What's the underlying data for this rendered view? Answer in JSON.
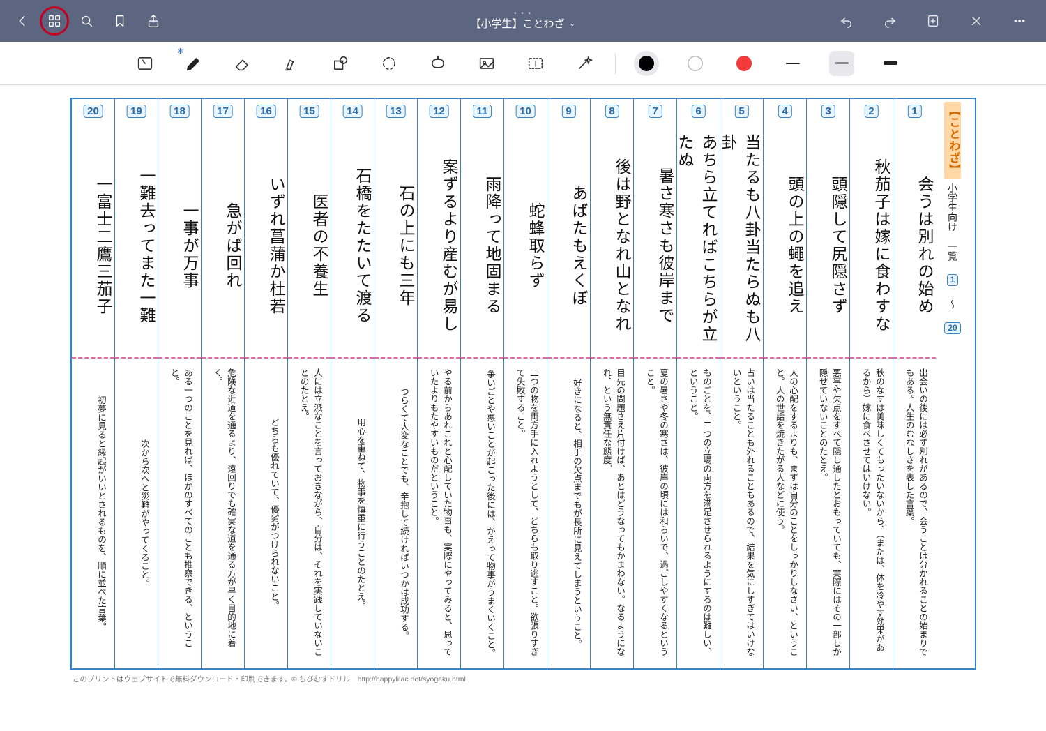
{
  "app": {
    "title": "【小学生】ことわざ"
  },
  "rightHeader": {
    "category": "【ことわざ】",
    "subtitle": "小学生向け　一覧",
    "rangeFrom": "1",
    "tilde": "〜",
    "rangeTo": "20"
  },
  "tools": {
    "colors": [
      {
        "hex": "#000000",
        "name": "black",
        "active": true
      },
      {
        "hex": "#ffffff",
        "name": "white",
        "active": false,
        "ring": true
      },
      {
        "hex": "#f23a3a",
        "name": "red",
        "active": false
      }
    ],
    "strokes": [
      {
        "h": 2,
        "active": false,
        "color": "#222"
      },
      {
        "h": 3,
        "active": true,
        "color": "#888"
      },
      {
        "h": 5,
        "active": false,
        "color": "#222"
      }
    ]
  },
  "columns": [
    {
      "n": 1,
      "phrase": "会うは別れの始め",
      "meaning": "出会いの後には必ず別れがあるので、会うことは分かれることの始まりでもある。人生のむなしさを表した言葉。"
    },
    {
      "n": 2,
      "phrase": "秋茄子は嫁に食わすな",
      "meaning": "秋のなすは美味しくてもったいないから、（または、体を冷やす効果があるから）嫁に食べさせてはいけない。"
    },
    {
      "n": 3,
      "phrase": "頭隠して尻隠さず",
      "meaning": "悪事や欠点をすべて隠し通したとおもっていても、実際にはその一部しか隠せていないことのたとえ。"
    },
    {
      "n": 4,
      "phrase": "頭の上の蠅を追え",
      "meaning": "人の心配をするよりも、まずは自分のことをしっかりしなさい、ということ。人の世話を焼きたがる人などに使う。"
    },
    {
      "n": 5,
      "phrase": "当たるも八卦当たらぬも八卦",
      "meaning": "占いは当たることも外れることもあるので、結果を気にしすぎてはいけないということ。"
    },
    {
      "n": 6,
      "phrase": "あちら立てればこちらが立たぬ",
      "meaning": "ものごとを、二つの立場の両方を満足させられるようにするのは難しい、ということ。"
    },
    {
      "n": 7,
      "phrase": "暑さ寒さも彼岸まで",
      "meaning": "夏の暑さや冬の寒さは、彼岸の頃には和らいで、過ごしやすくなるということ。"
    },
    {
      "n": 8,
      "phrase": "後は野となれ山となれ",
      "meaning": "目先の問題さえ片付けば、あとはどうなってもかまわない。なるようになれ、という無責任な態度。"
    },
    {
      "n": 9,
      "phrase": "あばたもえくぼ",
      "meaning": "好きになると、相手の欠点までもが長所に見えてしまうということ。"
    },
    {
      "n": 10,
      "phrase": "蛇蜂取らず",
      "meaning": "二つの物を両方手に入れようとして、どちらも取り逃すこと。欲張りすぎて失敗すること。"
    },
    {
      "n": 11,
      "phrase": "雨降って地固まる",
      "meaning": "争いごとや悪いことが起こった後には、かえって物事がうまくいくこと。"
    },
    {
      "n": 12,
      "phrase": "案ずるより産むが易し",
      "meaning": "やる前からあれこれと心配していた物事も、実際にやってみると、思っていたよりもたやすいものだということ。"
    },
    {
      "n": 13,
      "phrase": "石の上にも三年",
      "meaning": "つらくて大変なことでも、辛抱して続ければいつかは成功する。"
    },
    {
      "n": 14,
      "phrase": "石橋をたたいて渡る",
      "meaning": "用心を重ねて、物事を慎重に行うことのたとえ。"
    },
    {
      "n": 15,
      "phrase": "医者の不養生",
      "meaning": "人には立派なことを言っておきながら、自分は、それを実践していないことのたとえ。"
    },
    {
      "n": 16,
      "phrase": "いずれ菖蒲か杜若",
      "meaning": "どちらも優れていて、優劣がつけられないこと。"
    },
    {
      "n": 17,
      "phrase": "急がば回れ",
      "meaning": "危険な近道を通るより、遠回りでも確実な道を通る方が早く目的地に着く。"
    },
    {
      "n": 18,
      "phrase": "一事が万事",
      "meaning": "ある一つのことを見れば、ほかのすべてのことも推察できる、ということ。"
    },
    {
      "n": 19,
      "phrase": "一難去ってまた一難",
      "meaning": "次から次へと災難がやってくること。"
    },
    {
      "n": 20,
      "phrase": "一富士二鷹三茄子",
      "meaning": "初夢に見ると縁起がいいとされるものを、順に並べた言葉。"
    }
  ],
  "footer": "このプリントはウェブサイトで無料ダウンロード・印刷できます。© ちびむすドリル　http://happylilac.net/syogaku.html"
}
